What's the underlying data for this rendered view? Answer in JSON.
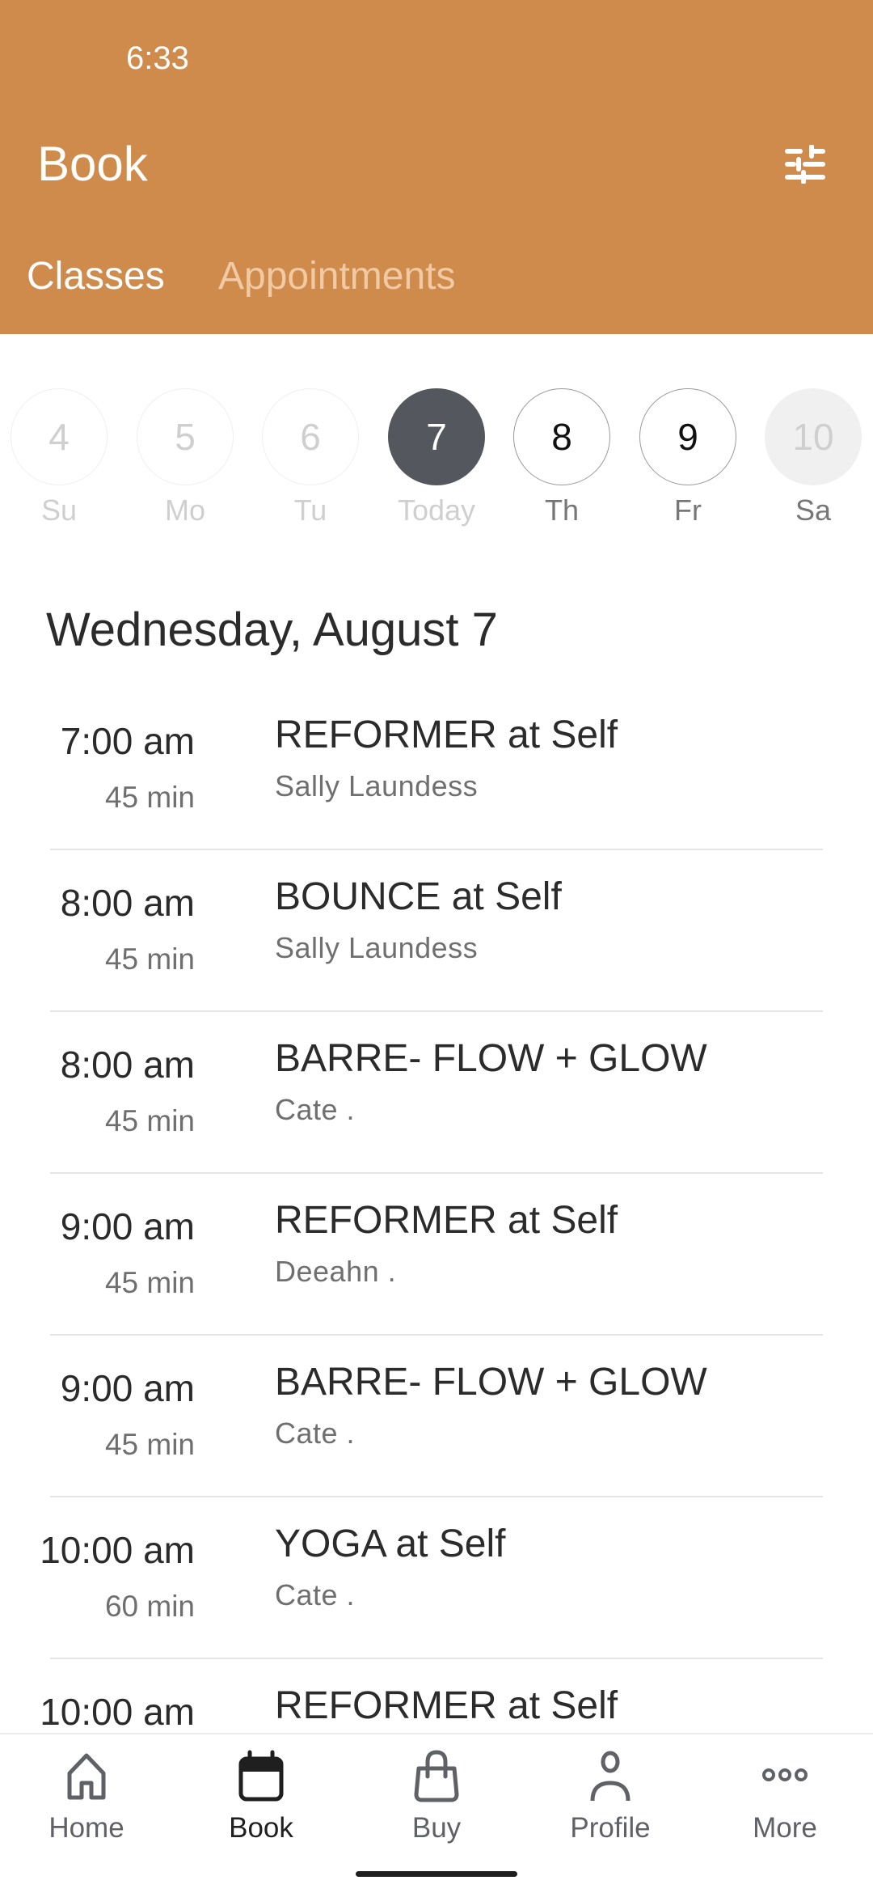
{
  "status_bar": {
    "time": "6:33"
  },
  "header": {
    "title": "Book",
    "filter_icon": "tune-sliders-icon",
    "background_color": "#CE8B4C"
  },
  "tabs": [
    {
      "label": "Classes",
      "active": true
    },
    {
      "label": "Appointments",
      "active": false
    }
  ],
  "date_strip": {
    "days": [
      {
        "number": "4",
        "label": "Su",
        "state": "past"
      },
      {
        "number": "5",
        "label": "Mo",
        "state": "past"
      },
      {
        "number": "6",
        "label": "Tu",
        "state": "past"
      },
      {
        "number": "7",
        "label": "Today",
        "state": "selected"
      },
      {
        "number": "8",
        "label": "Th",
        "state": "future"
      },
      {
        "number": "9",
        "label": "Fr",
        "state": "future"
      },
      {
        "number": "10",
        "label": "Sa",
        "state": "disabled"
      }
    ]
  },
  "schedule": {
    "date_heading": "Wednesday, August 7",
    "classes": [
      {
        "time": "7:00 am",
        "duration": "45 min",
        "name": "REFORMER at Self",
        "instructor": "Sally Laundess"
      },
      {
        "time": "8:00 am",
        "duration": "45 min",
        "name": "BOUNCE at Self",
        "instructor": "Sally Laundess"
      },
      {
        "time": "8:00 am",
        "duration": "45 min",
        "name": "BARRE- FLOW + GLOW",
        "instructor": "Cate ."
      },
      {
        "time": "9:00 am",
        "duration": "45 min",
        "name": "REFORMER at Self",
        "instructor": "Deeahn ."
      },
      {
        "time": "9:00 am",
        "duration": "45 min",
        "name": "BARRE- FLOW + GLOW",
        "instructor": "Cate ."
      },
      {
        "time": "10:00 am",
        "duration": "60 min",
        "name": "YOGA at Self",
        "instructor": "Cate ."
      },
      {
        "time": "10:00 am",
        "duration": "",
        "name": "REFORMER at Self",
        "instructor": ""
      }
    ]
  },
  "bottom_nav": {
    "items": [
      {
        "label": "Home",
        "icon": "home-icon",
        "active": false
      },
      {
        "label": "Book",
        "icon": "calendar-icon",
        "active": true
      },
      {
        "label": "Buy",
        "icon": "shopping-bag-icon",
        "active": false
      },
      {
        "label": "Profile",
        "icon": "person-icon",
        "active": false
      },
      {
        "label": "More",
        "icon": "more-dots-icon",
        "active": false
      }
    ]
  }
}
